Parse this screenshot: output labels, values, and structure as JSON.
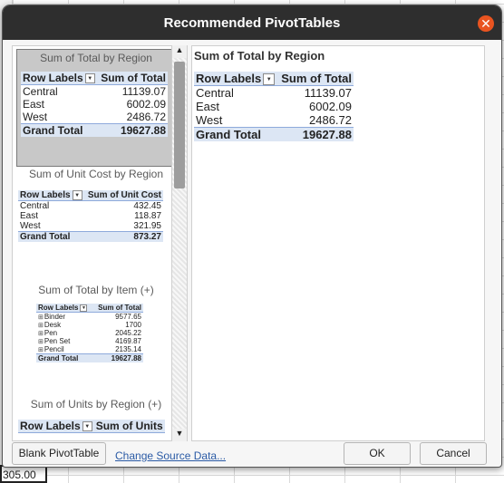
{
  "window": {
    "title": "Recommended PivotTables"
  },
  "sheet": {
    "active_cell_value": "305.00"
  },
  "previews": [
    {
      "title": "Sum of Total by Region",
      "header": [
        "Row Labels",
        "Sum of Total"
      ],
      "rows": [
        [
          "Central",
          "11139.07"
        ],
        [
          "East",
          "6002.09"
        ],
        [
          "West",
          "2486.72"
        ]
      ],
      "total": [
        "Grand Total",
        "19627.88"
      ]
    },
    {
      "title": "Sum of Unit Cost by Region",
      "header": [
        "Row Labels",
        "Sum of Unit Cost"
      ],
      "rows": [
        [
          "Central",
          "432.45"
        ],
        [
          "East",
          "118.87"
        ],
        [
          "West",
          "321.95"
        ]
      ],
      "total": [
        "Grand Total",
        "873.27"
      ]
    },
    {
      "title": "Sum of Total by Item (+)",
      "header": [
        "Row Labels",
        "Sum of Total"
      ],
      "rows": [
        [
          "Binder",
          "9577.65"
        ],
        [
          "Desk",
          "1700"
        ],
        [
          "Pen",
          "2045.22"
        ],
        [
          "Pen Set",
          "4169.87"
        ],
        [
          "Pencil",
          "2135.14"
        ]
      ],
      "total": [
        "Grand Total",
        "19627.88"
      ]
    },
    {
      "title": "Sum of Units by Region (+)",
      "header": [
        "Row Labels",
        "Sum of Units"
      ]
    }
  ],
  "detail": {
    "title": "Sum of Total by Region",
    "header": [
      "Row Labels",
      "Sum of Total"
    ],
    "rows": [
      [
        "Central",
        "11139.07"
      ],
      [
        "East",
        "6002.09"
      ],
      [
        "West",
        "2486.72"
      ]
    ],
    "total": [
      "Grand Total",
      "19627.88"
    ]
  },
  "buttons": {
    "blank": "Blank PivotTable",
    "change_source": "Change Source Data...",
    "ok": "OK",
    "cancel": "Cancel"
  },
  "icons": {
    "close": "close-icon",
    "scroll_up": "arrow-up-icon",
    "scroll_down": "arrow-down-icon",
    "dropdown": "filter-dropdown-icon",
    "expand": "expand-icon"
  },
  "colors": {
    "titlebar": "#2e2e2e",
    "close_button": "#e95420",
    "pivot_header": "#dce6f4",
    "link": "#2a5aa5"
  }
}
